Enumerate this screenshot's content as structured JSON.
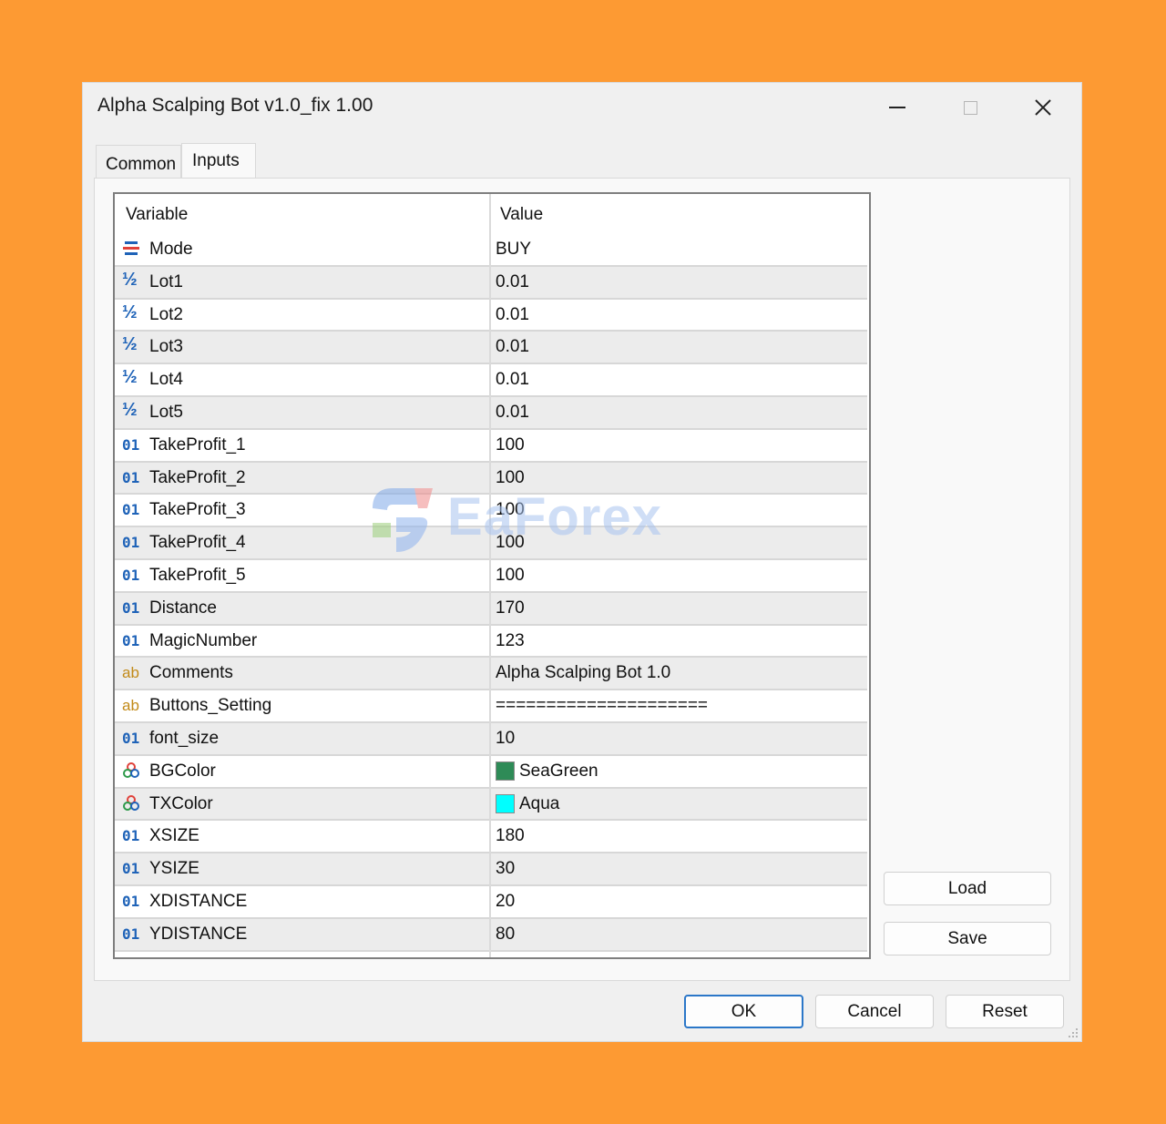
{
  "window": {
    "title": "Alpha Scalping Bot v1.0_fix 1.00"
  },
  "tabs": [
    {
      "label": "Common"
    },
    {
      "label": "Inputs"
    }
  ],
  "grid": {
    "headers": {
      "variable": "Variable",
      "value": "Value"
    },
    "rows": [
      {
        "icon": "enum-icon",
        "name": "Mode",
        "value": "BUY"
      },
      {
        "icon": "double-icon",
        "name": "Lot1",
        "value": "0.01"
      },
      {
        "icon": "double-icon",
        "name": "Lot2",
        "value": "0.01"
      },
      {
        "icon": "double-icon",
        "name": "Lot3",
        "value": "0.01"
      },
      {
        "icon": "double-icon",
        "name": "Lot4",
        "value": "0.01"
      },
      {
        "icon": "double-icon",
        "name": "Lot5",
        "value": "0.01"
      },
      {
        "icon": "integer-icon",
        "name": "TakeProfit_1",
        "value": "100"
      },
      {
        "icon": "integer-icon",
        "name": "TakeProfit_2",
        "value": "100"
      },
      {
        "icon": "integer-icon",
        "name": "TakeProfit_3",
        "value": "100"
      },
      {
        "icon": "integer-icon",
        "name": "TakeProfit_4",
        "value": "100"
      },
      {
        "icon": "integer-icon",
        "name": "TakeProfit_5",
        "value": "100"
      },
      {
        "icon": "integer-icon",
        "name": "Distance",
        "value": "170"
      },
      {
        "icon": "integer-icon",
        "name": "MagicNumber",
        "value": "123"
      },
      {
        "icon": "string-icon",
        "name": "Comments",
        "value": "Alpha Scalping Bot 1.0"
      },
      {
        "icon": "string-icon",
        "name": "Buttons_Setting",
        "value": "====================="
      },
      {
        "icon": "integer-icon",
        "name": "font_size",
        "value": "10"
      },
      {
        "icon": "color-icon",
        "name": "BGColor",
        "value": "SeaGreen",
        "swatch": "#2e8b57"
      },
      {
        "icon": "color-icon",
        "name": "TXColor",
        "value": "Aqua",
        "swatch": "#00ffff"
      },
      {
        "icon": "integer-icon",
        "name": "XSIZE",
        "value": "180"
      },
      {
        "icon": "integer-icon",
        "name": "YSIZE",
        "value": "30"
      },
      {
        "icon": "integer-icon",
        "name": "XDISTANCE",
        "value": "20"
      },
      {
        "icon": "integer-icon",
        "name": "YDISTANCE",
        "value": "80"
      }
    ]
  },
  "icon_glyphs": {
    "integer": "01",
    "double": "½",
    "string": "ab"
  },
  "buttons": {
    "load": "Load",
    "save": "Save",
    "ok": "OK",
    "cancel": "Cancel",
    "reset": "Reset"
  },
  "watermark": {
    "text": "EaForex"
  },
  "colors": {
    "background": "#fd9a33",
    "accent": "#2b77c8"
  }
}
